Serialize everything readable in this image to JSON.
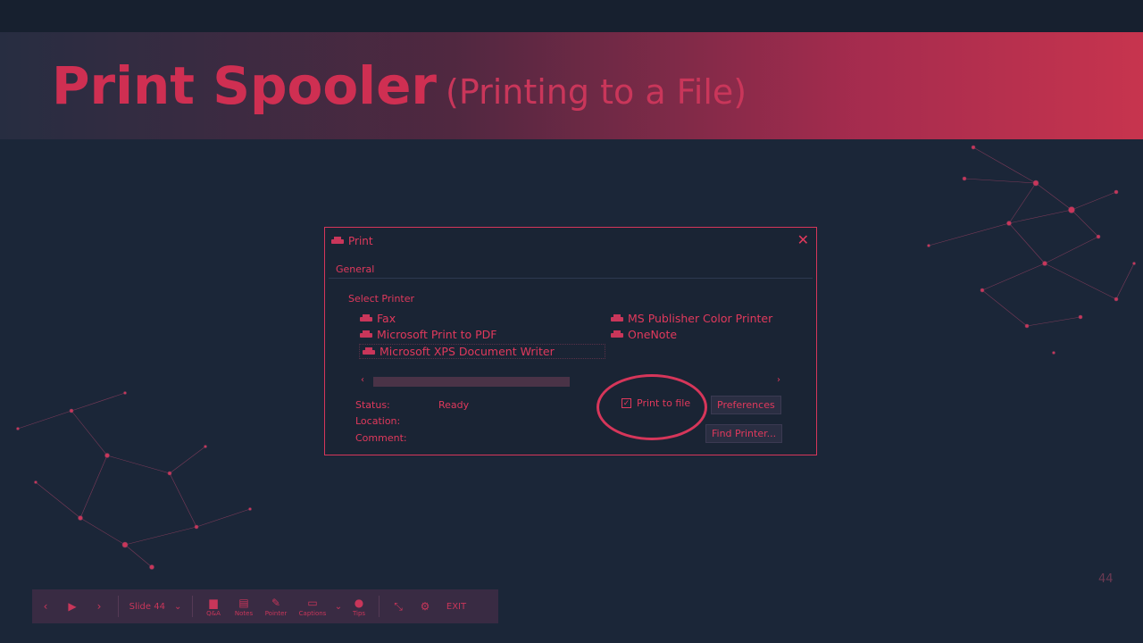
{
  "slide": {
    "title_main": "Print Spooler",
    "title_sub": "(Printing to a File)",
    "slide_number": "44"
  },
  "dialog": {
    "title": "Print",
    "tab": "General",
    "select_printer_label": "Select Printer",
    "printers_left": [
      "Fax",
      "Microsoft Print to PDF",
      "Microsoft XPS Document Writer"
    ],
    "printers_right": [
      "MS Publisher Color Printer",
      "OneNote"
    ],
    "status_label": "Status:",
    "status_value": "Ready",
    "location_label": "Location:",
    "comment_label": "Comment:",
    "print_to_file_label": "Print to file",
    "print_to_file_checked": true,
    "preferences_label": "Preferences",
    "find_printer_label": "Find Printer..."
  },
  "toolbar": {
    "slide_label": "Slide 44",
    "qa_label": "Q&A",
    "notes_label": "Notes",
    "pointer_label": "Pointer",
    "captions_label": "Captions",
    "tips_label": "Tips",
    "exit_label": "EXIT"
  },
  "colors": {
    "accent": "#e0395c",
    "background": "#1b2638",
    "dialog_bg": "#1a2434"
  }
}
